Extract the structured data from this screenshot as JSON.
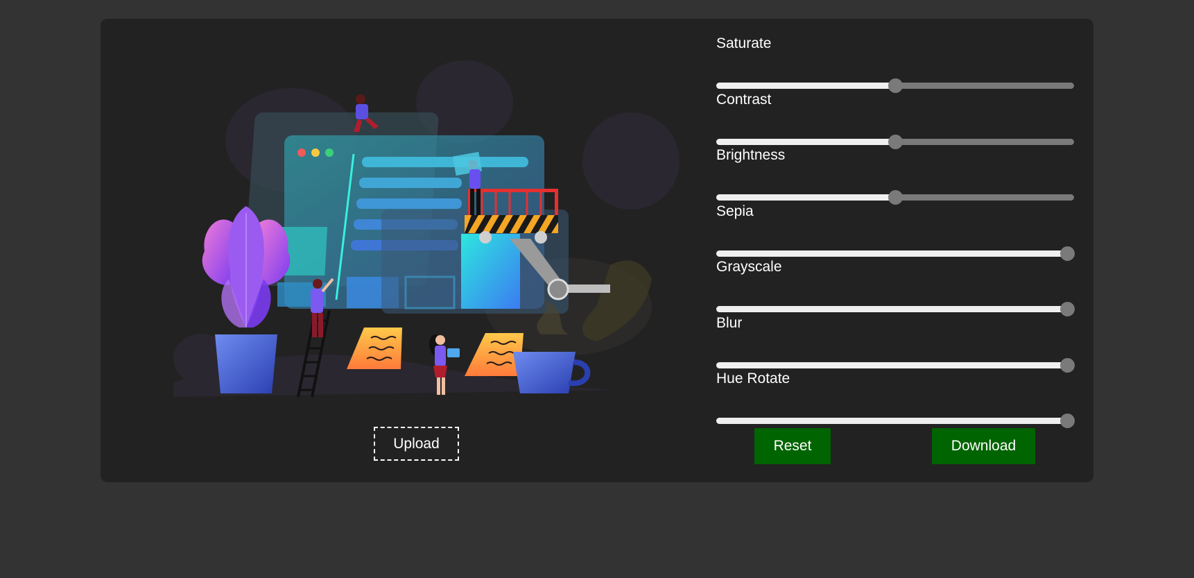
{
  "preview": {
    "upload_label": "Upload"
  },
  "filters": [
    {
      "label": "Saturate",
      "value_fraction": 0.5
    },
    {
      "label": "Contrast",
      "value_fraction": 0.5
    },
    {
      "label": "Brightness",
      "value_fraction": 0.5
    },
    {
      "label": "Sepia",
      "value_fraction": 1.0
    },
    {
      "label": "Grayscale",
      "value_fraction": 1.0
    },
    {
      "label": "Blur",
      "value_fraction": 1.0
    },
    {
      "label": "Hue Rotate",
      "value_fraction": 1.0
    }
  ],
  "actions": {
    "reset_label": "Reset",
    "download_label": "Download"
  },
  "colors": {
    "page_background": "#333333",
    "card_background": "#222222",
    "button_green": "#006400",
    "slider_fill": "#efefef",
    "slider_track": "#7a7a7a"
  }
}
